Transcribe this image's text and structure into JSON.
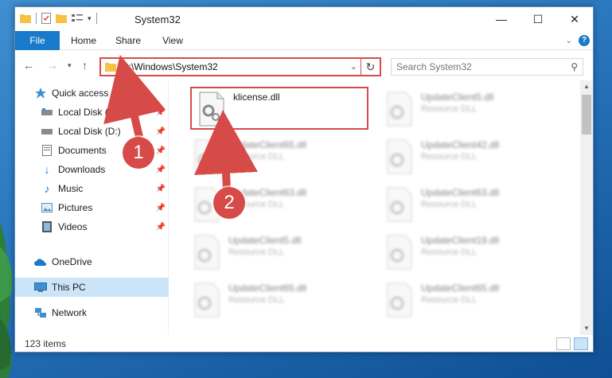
{
  "window": {
    "title": "System32",
    "controls": {
      "minimize": "—",
      "maximize": "☐",
      "close": "✕"
    }
  },
  "ribbon": {
    "tabs": [
      "File",
      "Home",
      "Share",
      "View"
    ],
    "help": "?"
  },
  "address": {
    "path": "C:\\Windows\\System32",
    "search_placeholder": "Search System32"
  },
  "nav": {
    "items": [
      {
        "label": "Quick access",
        "icon": "star-icon"
      },
      {
        "label": "Local Disk (C:)",
        "icon": "drive-icon",
        "pinned": true
      },
      {
        "label": "Local Disk (D:)",
        "icon": "drive-icon",
        "pinned": true
      },
      {
        "label": "Documents",
        "icon": "documents-icon",
        "pinned": true
      },
      {
        "label": "Downloads",
        "icon": "downloads-icon",
        "pinned": true
      },
      {
        "label": "Music",
        "icon": "music-icon",
        "pinned": true
      },
      {
        "label": "Pictures",
        "icon": "pictures-icon",
        "pinned": true
      },
      {
        "label": "Videos",
        "icon": "videos-icon",
        "pinned": true
      },
      {
        "label": "OneDrive",
        "icon": "cloud-icon"
      },
      {
        "label": "This PC",
        "icon": "pc-icon",
        "selected": true
      },
      {
        "label": "Network",
        "icon": "network-icon"
      }
    ]
  },
  "files": {
    "highlighted": {
      "name": "klicense.dll"
    },
    "blurred": [
      {
        "name": "UpdateClient5.dll",
        "type": "Resource DLL"
      },
      {
        "name": "UpdateClient65.dll",
        "type": "Resource DLL"
      },
      {
        "name": "UpdateClient42.dll",
        "type": "Resource DLL"
      },
      {
        "name": "UpdateClient63.dll",
        "type": "Resource DLL"
      },
      {
        "name": "UpdateClient63.dll",
        "type": "Resource DLL"
      },
      {
        "name": "UpdateClient5.dll",
        "type": "Resource DLL"
      },
      {
        "name": "UpdateClient19.dll",
        "type": "Resource DLL"
      },
      {
        "name": "UpdateClient65.dll",
        "type": "Resource DLL"
      },
      {
        "name": "UpdateClient65.dll",
        "type": "Resource DLL"
      }
    ]
  },
  "status": {
    "item_count": "123 items"
  },
  "annotations": {
    "step1": "1",
    "step2": "2"
  },
  "colors": {
    "accent": "#1979ca",
    "highlight_red": "#d94b4b",
    "selected_bg": "#cce4f7"
  }
}
